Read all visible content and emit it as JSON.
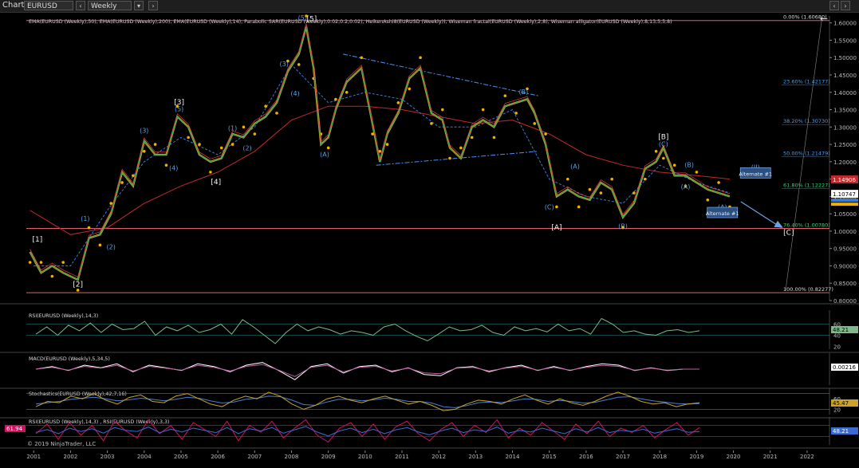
{
  "toolbar": {
    "title": "Chart",
    "instrument": "EURUSD",
    "timeframe": "Weekly"
  },
  "colors": {
    "background": "#000000",
    "ema50": "#28a745",
    "ema200": "#c0282b",
    "ema14": "#3a7bd5",
    "sar": "#f0b000",
    "fib": "#e8e8e8",
    "elliott_blue": "#5aa0e0",
    "osc_line": "#7fb98a",
    "macd": "#ffffff",
    "stoch_k": "#c9a227",
    "stoch_d": "#4a7fd0",
    "rsi_magenta": "#d01060"
  },
  "chart_data": [
    {
      "type": "line",
      "panel": "price",
      "title": "EMA(EURUSD (Weekly),50), EMA(EURUSD (Weekly),200), EMA(EURUSD (Weekly),14), Parabolic SAR(EURUSD (Weekly),0.02,0.2,0.02), HeikenAshi8(EURUSD (Weekly)), Wiseman fractal(EURUSD (Weekly),2,8), Wiseman alligator(EURUSD (Weekly),8,13,5,5,8)",
      "ylim": [
        0.8,
        1.62
      ],
      "xlim": [
        2000.8,
        2022.5
      ],
      "y_ticks": [
        "1.60000",
        "1.55000",
        "1.50000",
        "1.45000",
        "1.40000",
        "1.35000",
        "1.30000",
        "1.25000",
        "1.20000",
        "1.15000",
        "1.10000",
        "1.05000",
        "1.00000",
        "0.95000",
        "0.90000",
        "0.85000",
        "0.80000"
      ],
      "x_ticks": [
        "2001",
        "2002",
        "2003",
        "2004",
        "2005",
        "2006",
        "2007",
        "2008",
        "2009",
        "2010",
        "2011",
        "2012",
        "2013",
        "2014",
        "2015",
        "2016",
        "2017",
        "2018",
        "2019",
        "2020",
        "2021",
        "2022"
      ],
      "series": [
        {
          "key": "price",
          "x": [
            2000.9,
            2001.2,
            2001.5,
            2001.8,
            2002.2,
            2002.5,
            2002.8,
            2003.1,
            2003.4,
            2003.7,
            2004.0,
            2004.3,
            2004.6,
            2004.9,
            2005.2,
            2005.5,
            2005.8,
            2006.1,
            2006.4,
            2006.7,
            2007.0,
            2007.3,
            2007.6,
            2007.9,
            2008.2,
            2008.4,
            2008.6,
            2008.8,
            2009.0,
            2009.2,
            2009.5,
            2009.9,
            2010.2,
            2010.4,
            2010.6,
            2010.9,
            2011.2,
            2011.5,
            2011.8,
            2012.1,
            2012.3,
            2012.6,
            2012.9,
            2013.2,
            2013.5,
            2013.8,
            2014.1,
            2014.4,
            2014.6,
            2014.9,
            2015.2,
            2015.5,
            2015.8,
            2016.1,
            2016.4,
            2016.7,
            2017.0,
            2017.3,
            2017.6,
            2017.9,
            2018.1,
            2018.4,
            2018.7,
            2019.0,
            2019.3,
            2019.6,
            2019.9
          ],
          "y": [
            0.94,
            0.88,
            0.9,
            0.88,
            0.86,
            0.98,
            0.99,
            1.05,
            1.17,
            1.13,
            1.26,
            1.22,
            1.22,
            1.33,
            1.3,
            1.22,
            1.2,
            1.21,
            1.28,
            1.27,
            1.31,
            1.33,
            1.37,
            1.46,
            1.51,
            1.59,
            1.47,
            1.25,
            1.27,
            1.35,
            1.43,
            1.47,
            1.31,
            1.2,
            1.28,
            1.34,
            1.44,
            1.47,
            1.34,
            1.32,
            1.24,
            1.21,
            1.3,
            1.32,
            1.3,
            1.36,
            1.37,
            1.38,
            1.34,
            1.25,
            1.1,
            1.12,
            1.1,
            1.09,
            1.14,
            1.12,
            1.04,
            1.08,
            1.18,
            1.2,
            1.24,
            1.16,
            1.16,
            1.14,
            1.12,
            1.11,
            1.1
          ]
        },
        {
          "key": "ema200",
          "x": [
            2000.9,
            2002,
            2003,
            2004,
            2005,
            2006,
            2007,
            2008,
            2009,
            2010,
            2011,
            2012,
            2013,
            2014,
            2015,
            2016,
            2017,
            2018,
            2019,
            2019.9
          ],
          "y": [
            1.06,
            0.99,
            1.01,
            1.08,
            1.13,
            1.17,
            1.23,
            1.32,
            1.36,
            1.36,
            1.35,
            1.33,
            1.31,
            1.32,
            1.28,
            1.22,
            1.19,
            1.17,
            1.16,
            1.15
          ]
        },
        {
          "key": "ema50",
          "x": [
            2001,
            2002,
            2003,
            2004,
            2005,
            2006,
            2007,
            2008,
            2009,
            2010,
            2011,
            2012,
            2013,
            2014,
            2015,
            2016,
            2017,
            2018,
            2019,
            2019.9
          ],
          "y": [
            0.9,
            0.9,
            1.06,
            1.2,
            1.27,
            1.22,
            1.3,
            1.48,
            1.37,
            1.4,
            1.38,
            1.3,
            1.3,
            1.35,
            1.15,
            1.1,
            1.08,
            1.19,
            1.14,
            1.11
          ]
        }
      ],
      "price_labels": {
        "last": "1.10747",
        "ema200": "1.14906"
      },
      "fibonacci": [
        {
          "label": "0.00% (1.60680)",
          "value": 1.6068
        },
        {
          "label": "23.60% (1.42177)",
          "value": 1.42177
        },
        {
          "label": "38.20% (1.30730)",
          "value": 1.3073
        },
        {
          "label": "50.00% (1.21479)",
          "value": 1.21479
        },
        {
          "label": "61.80% (1.12227)",
          "value": 1.12227
        },
        {
          "label": "76.40% (1.00780)",
          "value": 1.0078
        },
        {
          "label": "100.00% (0.82277)",
          "value": 0.82277
        }
      ],
      "wave_labels": [
        {
          "text": "[1]",
          "x": 2001.1,
          "y": 0.97,
          "c": "w"
        },
        {
          "text": "[2]",
          "x": 2002.2,
          "y": 0.84,
          "c": "w"
        },
        {
          "text": "[3]",
          "x": 2004.95,
          "y": 1.365,
          "c": "w"
        },
        {
          "text": "[4]",
          "x": 2005.95,
          "y": 1.135,
          "c": "w"
        },
        {
          "text": "[5]",
          "x": 2008.55,
          "y": 1.605,
          "c": "w"
        },
        {
          "text": "[A]",
          "x": 2015.2,
          "y": 1.005,
          "c": "w"
        },
        {
          "text": "[B]",
          "x": 2018.1,
          "y": 1.265,
          "c": "w"
        },
        {
          "text": "[C]",
          "x": 2021.5,
          "y": 0.99,
          "c": "w"
        },
        {
          "text": "(1)",
          "x": 2002.4,
          "y": 1.03,
          "c": "b"
        },
        {
          "text": "(2)",
          "x": 2003.1,
          "y": 0.948,
          "c": "b"
        },
        {
          "text": "(3)",
          "x": 2004.0,
          "y": 1.283,
          "c": "b"
        },
        {
          "text": "(4)",
          "x": 2004.8,
          "y": 1.175,
          "c": "b"
        },
        {
          "text": "(5)",
          "x": 2004.95,
          "y": 1.345,
          "c": "b"
        },
        {
          "text": "(1)",
          "x": 2006.4,
          "y": 1.29,
          "c": "b"
        },
        {
          "text": "(2)",
          "x": 2006.8,
          "y": 1.233,
          "c": "b"
        },
        {
          "text": "(3)",
          "x": 2007.8,
          "y": 1.475,
          "c": "b"
        },
        {
          "text": "(4)",
          "x": 2008.1,
          "y": 1.39,
          "c": "b"
        },
        {
          "text": "(5)",
          "x": 2008.3,
          "y": 1.608,
          "c": "b"
        },
        {
          "text": "(A)",
          "x": 2008.9,
          "y": 1.215,
          "c": "b"
        },
        {
          "text": "(B)",
          "x": 2014.3,
          "y": 1.395,
          "c": "b"
        },
        {
          "text": "(C)",
          "x": 2015.0,
          "y": 1.063,
          "c": "b"
        },
        {
          "text": "(A)",
          "x": 2015.7,
          "y": 1.18,
          "c": "b"
        },
        {
          "text": "(B)",
          "x": 2017.0,
          "y": 1.008,
          "c": "b"
        },
        {
          "text": "(C)",
          "x": 2018.1,
          "y": 1.245,
          "c": "b"
        },
        {
          "text": "(B)",
          "x": 2018.8,
          "y": 1.185,
          "c": "b"
        },
        {
          "text": "(A)",
          "x": 2018.7,
          "y": 1.122,
          "c": "b"
        },
        {
          "text": "(II)",
          "x": 2020.6,
          "y": 1.178,
          "c": "b"
        },
        {
          "text": "(A)",
          "x": 2019.7,
          "y": 1.063,
          "c": "b"
        }
      ],
      "boxes": [
        {
          "text": "Alternate #1",
          "x": 2020.6,
          "y": 1.162
        },
        {
          "text": "Alternate #1",
          "x": 2019.7,
          "y": 1.048
        }
      ]
    },
    {
      "type": "line",
      "panel": "rsi1",
      "title": "RSI(EURUSD (Weekly),14,3)",
      "ylim": [
        15,
        85
      ],
      "y_ticks": [
        "60",
        "40",
        "20"
      ],
      "current": "48.21",
      "values": [
        42,
        55,
        40,
        58,
        48,
        62,
        45,
        60,
        50,
        52,
        65,
        40,
        55,
        48,
        58,
        45,
        50,
        60,
        42,
        68,
        55,
        40,
        25,
        45,
        60,
        48,
        55,
        50,
        42,
        48,
        45,
        40,
        55,
        60,
        48,
        38,
        30,
        42,
        55,
        48,
        50,
        58,
        45,
        40,
        55,
        48,
        52,
        46,
        60,
        48,
        52,
        42,
        70,
        60,
        45,
        48,
        42,
        40,
        48,
        50,
        45,
        48
      ]
    },
    {
      "type": "line",
      "panel": "macd",
      "title": "MACD(EURUSD (Weekly),5,34,5)",
      "current": "0.00216",
      "values": [
        0,
        0.02,
        -0.01,
        0.03,
        0.01,
        0.04,
        -0.02,
        0.03,
        0.01,
        -0.01,
        0.04,
        0.02,
        -0.02,
        0.03,
        0.05,
        -0.01,
        -0.08,
        0.02,
        0.04,
        -0.03,
        0.02,
        0.03,
        -0.02,
        0.01,
        -0.04,
        -0.05,
        0.01,
        0.02,
        -0.02,
        0.01,
        0.03,
        -0.01,
        0.02,
        -0.01,
        0.02,
        0.04,
        0.03,
        -0.01,
        0.01,
        -0.01,
        0.0,
        0.0
      ]
    },
    {
      "type": "line",
      "panel": "stoch",
      "title": "Stochastics(EURUSD (Weekly),42,7,16)",
      "ylim": [
        0,
        100
      ],
      "y_ticks": [
        "60",
        "20"
      ],
      "current": "45.47",
      "series": [
        {
          "key": "k",
          "values": [
            30,
            50,
            45,
            70,
            60,
            80,
            55,
            40,
            65,
            75,
            50,
            45,
            70,
            80,
            60,
            40,
            30,
            55,
            70,
            60,
            85,
            70,
            40,
            20,
            35,
            60,
            70,
            55,
            45,
            60,
            70,
            55,
            40,
            50,
            35,
            15,
            20,
            40,
            55,
            50,
            40,
            60,
            75,
            55,
            40,
            60,
            45,
            35,
            50,
            70,
            85,
            70,
            50,
            40,
            45,
            30,
            40,
            45
          ]
        },
        {
          "key": "d",
          "values": [
            40,
            45,
            50,
            58,
            62,
            66,
            60,
            52,
            56,
            62,
            58,
            52,
            58,
            66,
            62,
            52,
            44,
            48,
            58,
            62,
            70,
            68,
            55,
            38,
            35,
            48,
            58,
            58,
            52,
            56,
            62,
            58,
            50,
            50,
            44,
            30,
            26,
            34,
            45,
            48,
            46,
            52,
            60,
            58,
            50,
            54,
            50,
            44,
            46,
            56,
            66,
            68,
            60,
            52,
            48,
            42,
            40,
            42
          ]
        }
      ]
    },
    {
      "type": "line",
      "panel": "rsi2",
      "title": "RSI(EURUSD (Weekly),14,3) , RSI(EURUSD (Weekly),3,3)",
      "ylim": [
        0,
        100
      ],
      "current": "48.21",
      "current2": "61.94",
      "series": [
        {
          "key": "rsi3",
          "values": [
            40,
            75,
            20,
            80,
            35,
            70,
            15,
            85,
            50,
            25,
            90,
            40,
            70,
            20,
            80,
            55,
            30,
            85,
            15,
            70,
            45,
            85,
            25,
            60,
            90,
            35,
            10,
            60,
            80,
            30,
            75,
            20,
            65,
            85,
            40,
            15,
            55,
            80,
            30,
            70,
            45,
            90,
            25,
            60,
            35,
            80,
            50,
            20,
            75,
            40,
            85,
            30,
            60,
            45,
            70,
            25,
            55,
            80,
            35,
            62
          ]
        },
        {
          "key": "rsi14",
          "values": [
            45,
            55,
            40,
            60,
            48,
            58,
            42,
            62,
            52,
            48,
            64,
            44,
            56,
            46,
            60,
            52,
            44,
            62,
            40,
            58,
            50,
            62,
            42,
            54,
            66,
            46,
            32,
            50,
            60,
            44,
            56,
            40,
            54,
            62,
            46,
            36,
            50,
            60,
            44,
            54,
            48,
            64,
            42,
            52,
            46,
            60,
            50,
            40,
            58,
            46,
            62,
            44,
            52,
            48,
            56,
            42,
            50,
            58,
            45,
            48
          ]
        }
      ]
    }
  ],
  "footer": {
    "copyright": "© 2019 NinjaTrader, LLC"
  }
}
